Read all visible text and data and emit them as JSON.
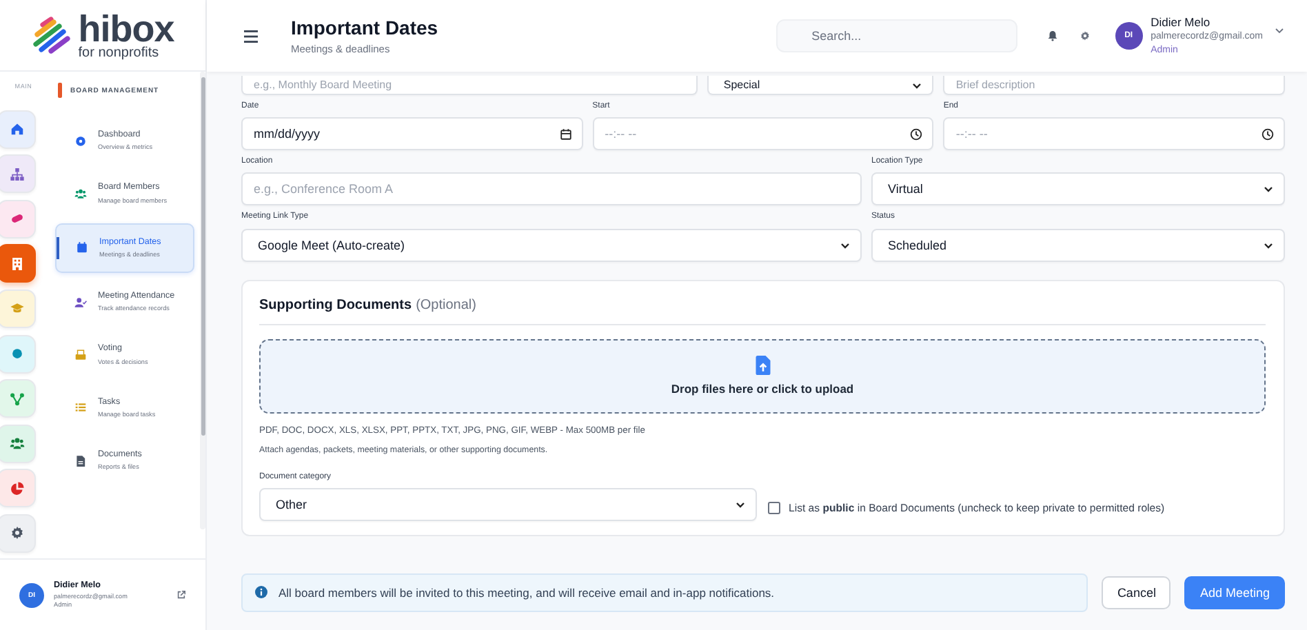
{
  "brand": {
    "name": "hibox",
    "tagline": "for nonprofits"
  },
  "rail": {
    "label": "MAIN",
    "items": [
      {
        "selected": false
      },
      {
        "selected": false
      },
      {
        "selected": false
      },
      {
        "selected": true
      },
      {
        "selected": false
      },
      {
        "selected": false
      },
      {
        "selected": false
      },
      {
        "selected": false
      },
      {
        "selected": false
      },
      {
        "selected": false
      }
    ]
  },
  "submenu": {
    "section": "BOARD MANAGEMENT",
    "items": [
      {
        "title": "Dashboard",
        "subtitle": "Overview & metrics",
        "selected": false
      },
      {
        "title": "Board Members",
        "subtitle": "Manage board members",
        "selected": false
      },
      {
        "title": "Important Dates",
        "subtitle": "Meetings & deadlines",
        "selected": true
      },
      {
        "title": "Meeting Attendance",
        "subtitle": "Track attendance records",
        "selected": false
      },
      {
        "title": "Voting",
        "subtitle": "Votes & decisions",
        "selected": false
      },
      {
        "title": "Tasks",
        "subtitle": "Manage board tasks",
        "selected": false
      },
      {
        "title": "Documents",
        "subtitle": "Reports & files",
        "selected": false
      }
    ]
  },
  "sidebar_user": {
    "initials": "DI",
    "name": "Didier Melo",
    "email": "palmerecordz@gmail.com",
    "role": "Admin"
  },
  "header": {
    "title": "Important Dates",
    "subtitle": "Meetings & deadlines",
    "search": {
      "placeholder": "Search..."
    },
    "user": {
      "initials": "DI",
      "name": "Didier Melo",
      "email": "palmerecordz@gmail.com",
      "role": "Admin"
    }
  },
  "form": {
    "rows": [
      [
        {
          "kind": "text",
          "placeholder": "e.g., Monthly Board Meeting"
        },
        {
          "kind": "select",
          "value": "Special"
        },
        {
          "kind": "text",
          "placeholder": "Brief description"
        }
      ],
      [
        {
          "label": "Date",
          "kind": "date",
          "placeholder": "mm/dd/yyyy"
        },
        {
          "label": "Start",
          "kind": "time",
          "placeholder": "--:-- --"
        },
        {
          "label": "End",
          "kind": "time",
          "placeholder": "--:-- --"
        }
      ],
      [
        {
          "label": "Location",
          "kind": "text",
          "placeholder": "e.g., Conference Room A"
        },
        {
          "label": "Location Type",
          "kind": "select",
          "value": "Virtual"
        }
      ],
      [
        {
          "label": "Meeting Link Type",
          "kind": "select",
          "value": "Google Meet (Auto-create)"
        },
        {
          "label": "Status",
          "kind": "select",
          "value": "Scheduled"
        }
      ]
    ]
  },
  "documents": {
    "title": "Supporting Documents",
    "title_note": "(Optional)",
    "dropzone": "Drop files here or click to upload",
    "formats": "PDF, DOC, DOCX, XLS, XLSX, PPT, PPTX, TXT, JPG, PNG, GIF, WEBP - Max 500MB per file",
    "hint": "Attach agendas, packets, meeting materials, or other supporting documents.",
    "category_label": "Document category",
    "category": "Other",
    "public_label": "List as **public** in Board Documents (uncheck to keep private to permitted roles)",
    "public_checked": false
  },
  "footer": {
    "notice": "All board members will be invited to this meeting, and will receive email and in-app notifications.",
    "buttons": [
      {
        "label": "Cancel",
        "kind": "secondary"
      },
      {
        "label": "Add Meeting",
        "kind": "primary"
      }
    ]
  }
}
